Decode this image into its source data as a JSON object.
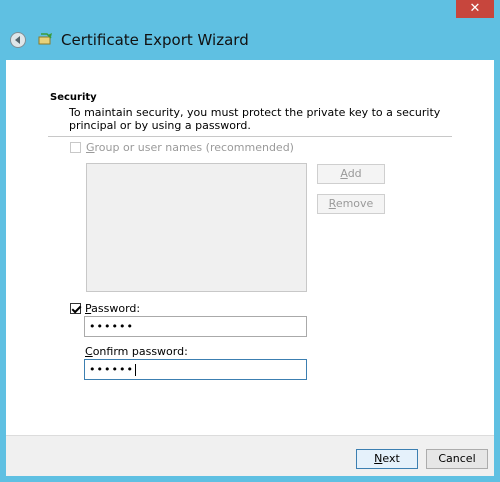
{
  "window": {
    "close_glyph": "✕",
    "title": "Certificate Export Wizard"
  },
  "page": {
    "section_heading": "Security",
    "section_description": "To maintain security, you must protect the private key to a security principal or by using a password."
  },
  "group_option": {
    "label": "Group or user names (recommended)",
    "checked": false,
    "enabled": false
  },
  "buttons": {
    "add": "Add",
    "remove": "Remove",
    "next": "Next",
    "cancel": "Cancel"
  },
  "password": {
    "checkbox_label": "Password:",
    "checked": true,
    "value_masked": "••••••",
    "confirm_label": "Confirm password:",
    "confirm_value_masked": "••••••"
  }
}
